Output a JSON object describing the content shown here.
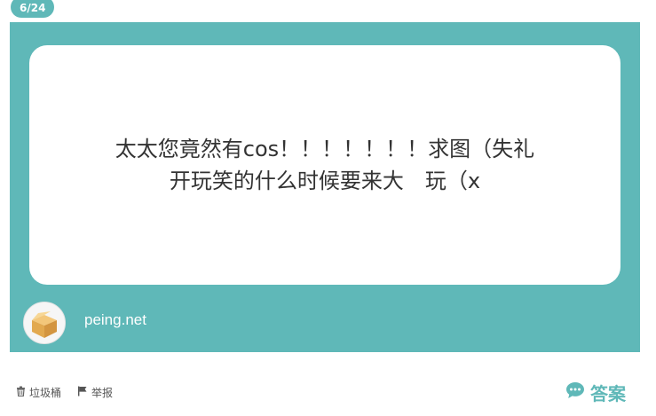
{
  "header": {
    "page_counter": "6/24"
  },
  "question": {
    "text": "太太您竟然有cos！！！！！！！求图（失礼\n开玩笑的什么时候要来大　玩（x"
  },
  "footer": {
    "site": "peing.net"
  },
  "actions": {
    "trash_label": "垃圾桶",
    "report_label": "举报",
    "answer_label": "答案"
  },
  "colors": {
    "accent": "#5fb8b8",
    "card_bg": "#ffffff",
    "text": "#333333"
  },
  "icons": {
    "avatar": "cardboard-box-icon",
    "trash": "trash-icon",
    "report": "flag-icon",
    "answer": "speech-bubble-icon"
  }
}
